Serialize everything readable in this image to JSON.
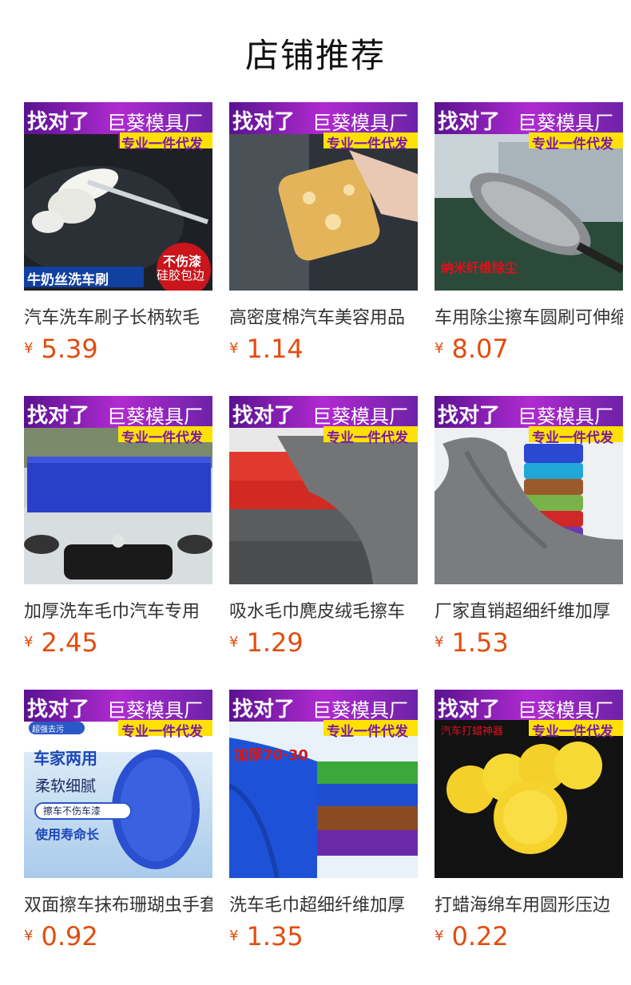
{
  "page_title": "店铺推荐",
  "banner": {
    "left_text": "找对了",
    "right_text": "巨葵模具厂",
    "sub_text": "专业一件代发"
  },
  "products": [
    {
      "name": "汽车洗车刷子长柄软毛",
      "currency": "¥",
      "price": "5.39",
      "overlay_texts": [
        "牛奶丝洗车刷",
        "不伤漆",
        "硅胶包边"
      ]
    },
    {
      "name": "高密度棉汽车美容用品",
      "currency": "¥",
      "price": "1.14",
      "overlay_texts": []
    },
    {
      "name": "车用除尘擦车圆刷可伸缩",
      "currency": "¥",
      "price": "8.07",
      "overlay_texts": [
        "纳米纤维除尘"
      ]
    },
    {
      "name": "加厚洗车毛巾汽车专用",
      "currency": "¥",
      "price": "2.45",
      "overlay_texts": []
    },
    {
      "name": "吸水毛巾麂皮绒毛擦车",
      "currency": "¥",
      "price": "1.29",
      "overlay_texts": []
    },
    {
      "name": "厂家直销超细纤维加厚",
      "currency": "¥",
      "price": "1.53",
      "overlay_texts": []
    },
    {
      "name": "双面擦车抹布珊瑚虫手套",
      "currency": "¥",
      "price": "0.92",
      "overlay_texts": [
        "超强去污",
        "车家两用",
        "柔软细腻",
        "擦车不伤车漆",
        "使用寿命长"
      ]
    },
    {
      "name": "洗车毛巾超细纤维加厚",
      "currency": "¥",
      "price": "1.35",
      "overlay_texts": [
        "加厚70·30"
      ]
    },
    {
      "name": "打蜡海绵车用圆形压边",
      "currency": "¥",
      "price": "0.22",
      "overlay_texts": [
        "汽车打蜡神器"
      ]
    }
  ],
  "colors": {
    "price": "#e24c0f",
    "banner_purple": "#8a1fb8",
    "banner_yellow": "#ffe100"
  }
}
